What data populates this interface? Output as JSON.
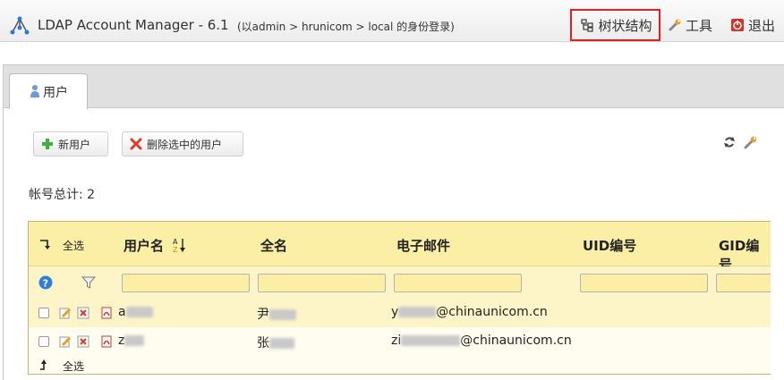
{
  "header": {
    "app_title": "LDAP Account Manager - 6.1",
    "login_info": "(以admin > hrunicom > local 的身份登录)",
    "tree_label": "树状结构",
    "tools_label": "工具",
    "logout_label": "退出",
    "highlight_color": "#e02020"
  },
  "tabs": [
    {
      "label": "用户"
    }
  ],
  "toolbar": {
    "new_user_label": "新用户",
    "delete_selected_label": "删除选中的用户"
  },
  "account_count": "帐号总计: 2",
  "table": {
    "select_all_label": "全选",
    "columns": [
      "用户名",
      "全名",
      "电子邮件",
      "UID编号",
      "GID编号"
    ],
    "rows": [
      {
        "username": "a",
        "fullname": "尹",
        "email_prefix": "y",
        "email_domain": "@chinaunicom.cn"
      },
      {
        "username": "z",
        "fullname": "张",
        "email_prefix": "zi",
        "email_domain": "@chinaunicom.cn"
      }
    ],
    "footer_select_all_label": "全选"
  },
  "colors": {
    "header_row": "#fbeea5",
    "row_odd": "#fdf5c8",
    "row_even": "#fffdf0"
  }
}
